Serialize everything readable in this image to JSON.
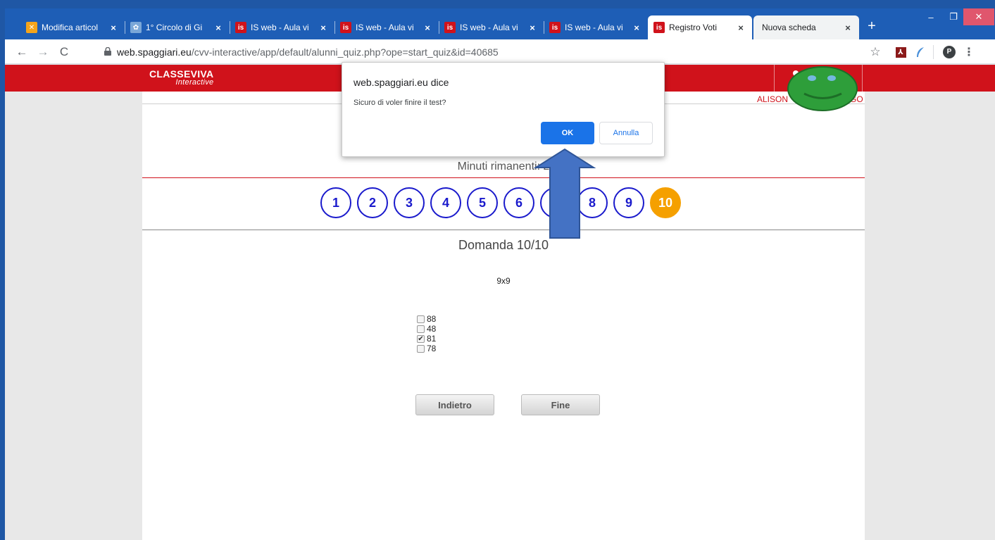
{
  "browser": {
    "tabs": [
      {
        "title": "Modifica articol",
        "favicon": "joomla-icon",
        "color": "#f4a41b"
      },
      {
        "title": "1° Circolo di Gi",
        "favicon": "school-logo-icon",
        "color": "#7aa7d8"
      },
      {
        "title": "IS web - Aula vi",
        "favicon": "is-logo-icon",
        "color": "#d0121b"
      },
      {
        "title": "IS web - Aula vi",
        "favicon": "is-logo-icon",
        "color": "#d0121b"
      },
      {
        "title": "IS web - Aula vi",
        "favicon": "is-logo-icon",
        "color": "#d0121b"
      },
      {
        "title": "IS web - Aula vi",
        "favicon": "is-logo-icon",
        "color": "#d0121b"
      },
      {
        "title": "Registro Voti",
        "favicon": "is-logo-icon",
        "color": "#d0121b"
      },
      {
        "title": "Nuova scheda",
        "favicon": "",
        "color": ""
      }
    ],
    "favicon_text": "is",
    "new_tab": "+",
    "close_glyph": "×",
    "url_host": "web.spaggiari.eu",
    "url_path": "/cvv-interactive/app/default/alunni_quiz.php?ope=start_quiz&id=40685",
    "profile_initial": "P"
  },
  "site": {
    "logo_main": "CLASSEVIVA",
    "logo_sub": "Interactive",
    "user_name": "ALISON",
    "user_name_tail": "GO"
  },
  "quiz": {
    "timer_label": "Minuti rimanenti: 2",
    "question_numbers": [
      "1",
      "2",
      "3",
      "4",
      "5",
      "6",
      "7",
      "8",
      "9",
      "10"
    ],
    "current_question": "10",
    "question_title": "Domanda 10/10",
    "question_text": "9x9",
    "answers": [
      {
        "label": "88",
        "checked": false
      },
      {
        "label": "48",
        "checked": false
      },
      {
        "label": "81",
        "checked": true
      },
      {
        "label": "78",
        "checked": false
      }
    ],
    "back_label": "Indietro",
    "finish_label": "Fine"
  },
  "dialog": {
    "title": "web.spaggiari.eu dice",
    "message": "Sicuro di voler finire il test?",
    "ok_label": "OK",
    "cancel_label": "Annulla"
  },
  "annotations": {
    "arrow_color": "#4472c4",
    "smiley_color": "#2e9e3a"
  }
}
